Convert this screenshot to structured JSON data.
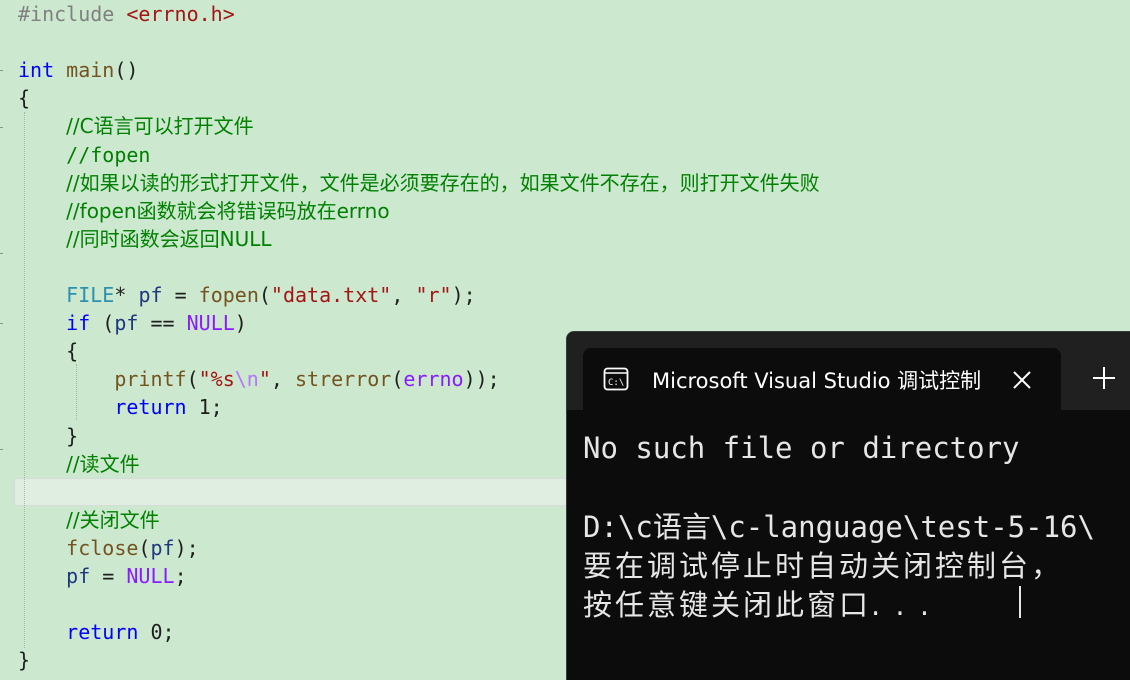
{
  "editor": {
    "lines": [
      {
        "parts": [
          {
            "c": "pp",
            "t": "#include "
          },
          {
            "c": "str",
            "t": "<errno.h>"
          }
        ]
      },
      {
        "parts": []
      },
      {
        "parts": [
          {
            "c": "kw",
            "t": "int"
          },
          {
            "c": "punc",
            "t": " "
          },
          {
            "c": "fn",
            "t": "main"
          },
          {
            "c": "punc",
            "t": "()"
          }
        ]
      },
      {
        "parts": [
          {
            "c": "punc",
            "t": "{"
          }
        ]
      },
      {
        "parts": [
          {
            "c": "ind",
            "t": "    "
          },
          {
            "c": "cm",
            "t": "//C语言可以打开文件"
          }
        ]
      },
      {
        "parts": [
          {
            "c": "ind",
            "t": "    "
          },
          {
            "c": "cm",
            "t": "//fopen"
          }
        ]
      },
      {
        "parts": [
          {
            "c": "ind",
            "t": "    "
          },
          {
            "c": "cm",
            "t": "//如果以读的形式打开文件，文件是必须要存在的，如果文件不存在，则打开文件失败"
          }
        ]
      },
      {
        "parts": [
          {
            "c": "ind",
            "t": "    "
          },
          {
            "c": "cm",
            "t": "//fopen函数就会将错误码放在errno"
          }
        ]
      },
      {
        "parts": [
          {
            "c": "ind",
            "t": "    "
          },
          {
            "c": "cm",
            "t": "//同时函数会返回NULL"
          }
        ]
      },
      {
        "parts": []
      },
      {
        "parts": [
          {
            "c": "ind",
            "t": "    "
          },
          {
            "c": "ty",
            "t": "FILE"
          },
          {
            "c": "punc",
            "t": "* "
          },
          {
            "c": "var",
            "t": "pf"
          },
          {
            "c": "punc",
            "t": " = "
          },
          {
            "c": "fn",
            "t": "fopen"
          },
          {
            "c": "punc",
            "t": "("
          },
          {
            "c": "str",
            "t": "\"data.txt\""
          },
          {
            "c": "punc",
            "t": ", "
          },
          {
            "c": "str",
            "t": "\"r\""
          },
          {
            "c": "punc",
            "t": ");"
          }
        ]
      },
      {
        "parts": [
          {
            "c": "ind",
            "t": "    "
          },
          {
            "c": "kw",
            "t": "if"
          },
          {
            "c": "punc",
            "t": " ("
          },
          {
            "c": "var",
            "t": "pf"
          },
          {
            "c": "punc",
            "t": " == "
          },
          {
            "c": "mac",
            "t": "NULL"
          },
          {
            "c": "punc",
            "t": ")"
          }
        ]
      },
      {
        "parts": [
          {
            "c": "ind",
            "t": "    "
          },
          {
            "c": "punc",
            "t": "{"
          }
        ]
      },
      {
        "parts": [
          {
            "c": "ind",
            "t": "        "
          },
          {
            "c": "fn",
            "t": "printf"
          },
          {
            "c": "punc",
            "t": "("
          },
          {
            "c": "str",
            "t": "\"%s"
          },
          {
            "c": "esc",
            "t": "\\n"
          },
          {
            "c": "str",
            "t": "\""
          },
          {
            "c": "punc",
            "t": ", "
          },
          {
            "c": "fn",
            "t": "strerror"
          },
          {
            "c": "punc",
            "t": "("
          },
          {
            "c": "mac",
            "t": "errno"
          },
          {
            "c": "punc",
            "t": "));"
          }
        ]
      },
      {
        "parts": [
          {
            "c": "ind",
            "t": "        "
          },
          {
            "c": "kw",
            "t": "return"
          },
          {
            "c": "punc",
            "t": " "
          },
          {
            "c": "num",
            "t": "1"
          },
          {
            "c": "punc",
            "t": ";"
          }
        ]
      },
      {
        "parts": [
          {
            "c": "ind",
            "t": "    "
          },
          {
            "c": "punc",
            "t": "}"
          }
        ]
      },
      {
        "parts": [
          {
            "c": "ind",
            "t": "    "
          },
          {
            "c": "cm",
            "t": "//读文件"
          }
        ]
      },
      {
        "parts": []
      },
      {
        "parts": [
          {
            "c": "ind",
            "t": "    "
          },
          {
            "c": "cm",
            "t": "//关闭文件"
          }
        ]
      },
      {
        "parts": [
          {
            "c": "ind",
            "t": "    "
          },
          {
            "c": "fn",
            "t": "fclose"
          },
          {
            "c": "punc",
            "t": "("
          },
          {
            "c": "var",
            "t": "pf"
          },
          {
            "c": "punc",
            "t": ");"
          }
        ]
      },
      {
        "parts": [
          {
            "c": "ind",
            "t": "    "
          },
          {
            "c": "var",
            "t": "pf"
          },
          {
            "c": "punc",
            "t": " = "
          },
          {
            "c": "mac",
            "t": "NULL"
          },
          {
            "c": "punc",
            "t": ";"
          }
        ]
      },
      {
        "parts": []
      },
      {
        "parts": [
          {
            "c": "ind",
            "t": "    "
          },
          {
            "c": "kw",
            "t": "return"
          },
          {
            "c": "punc",
            "t": " "
          },
          {
            "c": "num",
            "t": "0"
          },
          {
            "c": "punc",
            "t": ";"
          }
        ]
      },
      {
        "parts": [
          {
            "c": "punc",
            "t": "}"
          }
        ]
      }
    ]
  },
  "console": {
    "tab_icon": "console-icon",
    "tab_title": "Microsoft Visual Studio 调试控制台",
    "close_icon": "close-icon",
    "new_tab_icon": "plus-icon",
    "output": {
      "line1": "No such file or directory",
      "line2": "D:\\c语言\\c-language\\test-5-16\\",
      "line3": "要在调试停止时自动关闭控制台，",
      "line4": "按任意键关闭此窗口. . ."
    }
  }
}
